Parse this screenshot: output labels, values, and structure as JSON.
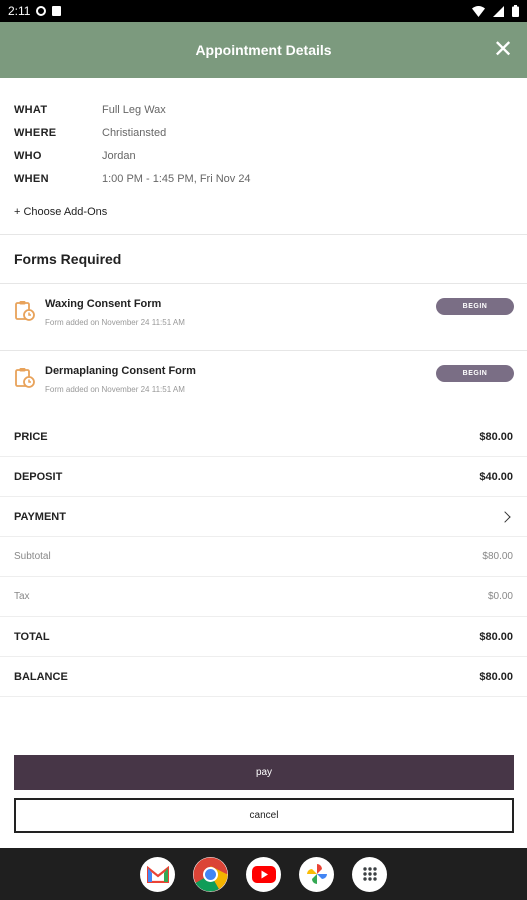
{
  "status_bar": {
    "time": "2:11"
  },
  "header": {
    "title": "Appointment Details"
  },
  "details": [
    {
      "label": "WHAT",
      "value": "Full Leg Wax"
    },
    {
      "label": "WHERE",
      "value": "Christiansted"
    },
    {
      "label": "WHO",
      "value": "Jordan"
    },
    {
      "label": "WHEN",
      "value": "1:00 PM - 1:45 PM, Fri Nov 24"
    }
  ],
  "add_ons_label": "+ Choose Add-Ons",
  "forms": {
    "title": "Forms Required",
    "items": [
      {
        "name": "Waxing Consent Form",
        "subtitle": "Form added on November 24 11:51 AM",
        "button": "BEGIN"
      },
      {
        "name": "Dermaplaning Consent Form",
        "subtitle": "Form added on November 24 11:51 AM",
        "button": "BEGIN"
      }
    ]
  },
  "pricing": {
    "price": {
      "label": "PRICE",
      "value": "$80.00"
    },
    "deposit": {
      "label": "DEPOSIT",
      "value": "$40.00"
    },
    "payment": {
      "label": "PAYMENT"
    },
    "subtotal": {
      "label": "Subtotal",
      "value": "$80.00"
    },
    "tax": {
      "label": "Tax",
      "value": "$0.00"
    },
    "total": {
      "label": "TOTAL",
      "value": "$80.00"
    },
    "balance": {
      "label": "BALANCE",
      "value": "$80.00"
    }
  },
  "actions": {
    "pay": "pay",
    "cancel": "cancel"
  },
  "colors": {
    "header": "#7c9a7e",
    "pay_button": "#473647",
    "begin_badge": "#7a6e85",
    "form_icon": "#e8a25a"
  },
  "dock": [
    "gmail-icon",
    "chrome-icon",
    "youtube-icon",
    "photos-icon",
    "apps-icon"
  ]
}
